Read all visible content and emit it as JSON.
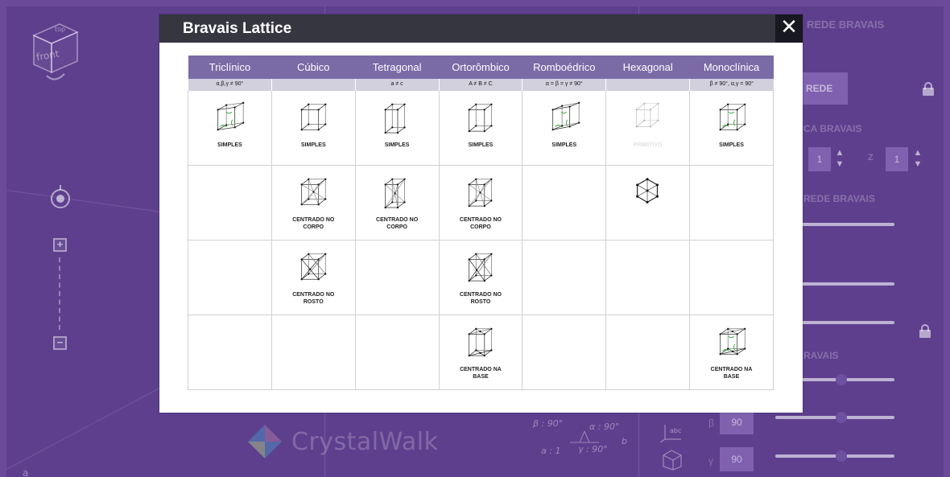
{
  "modal": {
    "title": "Bravais Lattice",
    "close_label": "✕",
    "columns": [
      {
        "name": "Triclínico",
        "condition": "α,β,γ ≠ 90°"
      },
      {
        "name": "Cúbico",
        "condition": ""
      },
      {
        "name": "Tetragonal",
        "condition": "a ≠ c"
      },
      {
        "name": "Ortorômbico",
        "condition": "A ≠ B ≠ C"
      },
      {
        "name": "Romboédrico",
        "condition": "α = β = γ ≠ 90°"
      },
      {
        "name": "Hexagonal",
        "condition": ""
      },
      {
        "name": "Monoclínica",
        "condition": "β ≠ 90°, α,γ = 90°"
      }
    ],
    "rows": [
      [
        "SIMPLES",
        "SIMPLES",
        "SIMPLES",
        "SIMPLES",
        "SIMPLES",
        "PRIMITIVO",
        "SIMPLES"
      ],
      [
        "",
        "CENTRADO NO CORPO",
        "CENTRADO NO CORPO",
        "CENTRADO NO CORPO",
        "",
        "",
        ""
      ],
      [
        "",
        "CENTRADO NO ROSTO",
        "",
        "CENTRADO NO ROSTO",
        "",
        "",
        ""
      ],
      [
        "",
        "",
        "",
        "CENTRADO NA BASE",
        "",
        "",
        "CENTRADO NA BASE"
      ]
    ],
    "cell_images": [
      [
        "triclinic-lattice-icon",
        "cubic-simple-icon",
        "tetragonal-simple-icon",
        "orthorhombic-simple-icon",
        "rhombohedral-icon",
        "hexagonal-primitive-icon",
        "monoclinic-simple-icon"
      ],
      [
        "",
        "cubic-body-centered-icon",
        "tetragonal-body-centered-icon",
        "orthorhombic-body-centered-icon",
        "",
        "hexagonal-prism-icon",
        ""
      ],
      [
        "",
        "cubic-face-centered-icon",
        "",
        "orthorhombic-face-centered-icon",
        "",
        "",
        ""
      ],
      [
        "",
        "",
        "",
        "orthorhombic-base-centered-icon",
        "",
        "",
        "monoclinic-base-centered-icon"
      ]
    ]
  },
  "background": {
    "cube_face_label": "front",
    "cube_top_label": "top",
    "logo_text": "CrystalWalk",
    "right_panel": {
      "heading": "REDE BRAVAIS",
      "button_label": "REDE",
      "section_1": "CA BRAVAIS",
      "section_2": "REDE BRAVAIS",
      "section_3": "RAVAIS",
      "step_1_value": "1",
      "z_label": "Z",
      "z_value": "1",
      "beta_label": "β",
      "beta_value": "90",
      "gamma_label": "γ",
      "gamma_value": "90"
    },
    "angle_readout": {
      "beta": "β : 90°",
      "alpha": "α : 90°",
      "gamma": "γ : 90°",
      "a_axis": "a : 1",
      "b_axis": "b"
    },
    "corner_label": "a"
  },
  "colors": {
    "background": "#5e3f8e",
    "modal_header": "#363640",
    "table_header": "#7a6aa6",
    "condition_row": "#d3d0de",
    "lattice_green": "#2eaa2e"
  }
}
